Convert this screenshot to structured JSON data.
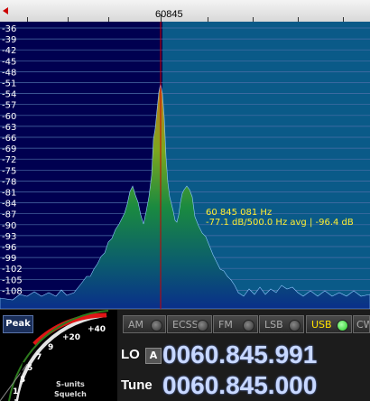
{
  "scale": {
    "center_freq_label": "60845"
  },
  "spectrum": {
    "db_labels": [
      "-36",
      "-39",
      "-42",
      "-45",
      "-48",
      "-51",
      "-54",
      "-57",
      "-60",
      "-63",
      "-66",
      "-69",
      "-72",
      "-75",
      "-78",
      "-81",
      "-84",
      "-87",
      "-90",
      "-93",
      "-96",
      "-99",
      "-102",
      "-105",
      "-108"
    ],
    "marker_freq": "60 845 081 Hz",
    "marker_readout": "-77.1 dB/500.0 Hz avg | -96.4 dB",
    "colors": {
      "background_left": "#000050",
      "background_right": "#0a5a88",
      "marker_line": "#cc0000",
      "readout": "#ffee33"
    }
  },
  "meter": {
    "peak_label": "Peak",
    "scale_labels": [
      "+40",
      "+20",
      "9",
      "7",
      "5",
      "3",
      "1"
    ],
    "caption_1": "S-units",
    "caption_2": "Squelch"
  },
  "modes": [
    {
      "label": "AM",
      "active": false
    },
    {
      "label": "ECSS",
      "active": false
    },
    {
      "label": "FM",
      "active": false
    },
    {
      "label": "LSB",
      "active": false
    },
    {
      "label": "USB",
      "active": true
    },
    {
      "label": "CW",
      "active": false
    }
  ],
  "lo": {
    "label": "LO",
    "a_label": "A",
    "value": "0060.845.991"
  },
  "tune": {
    "label": "Tune",
    "value": "0060.845.000"
  }
}
